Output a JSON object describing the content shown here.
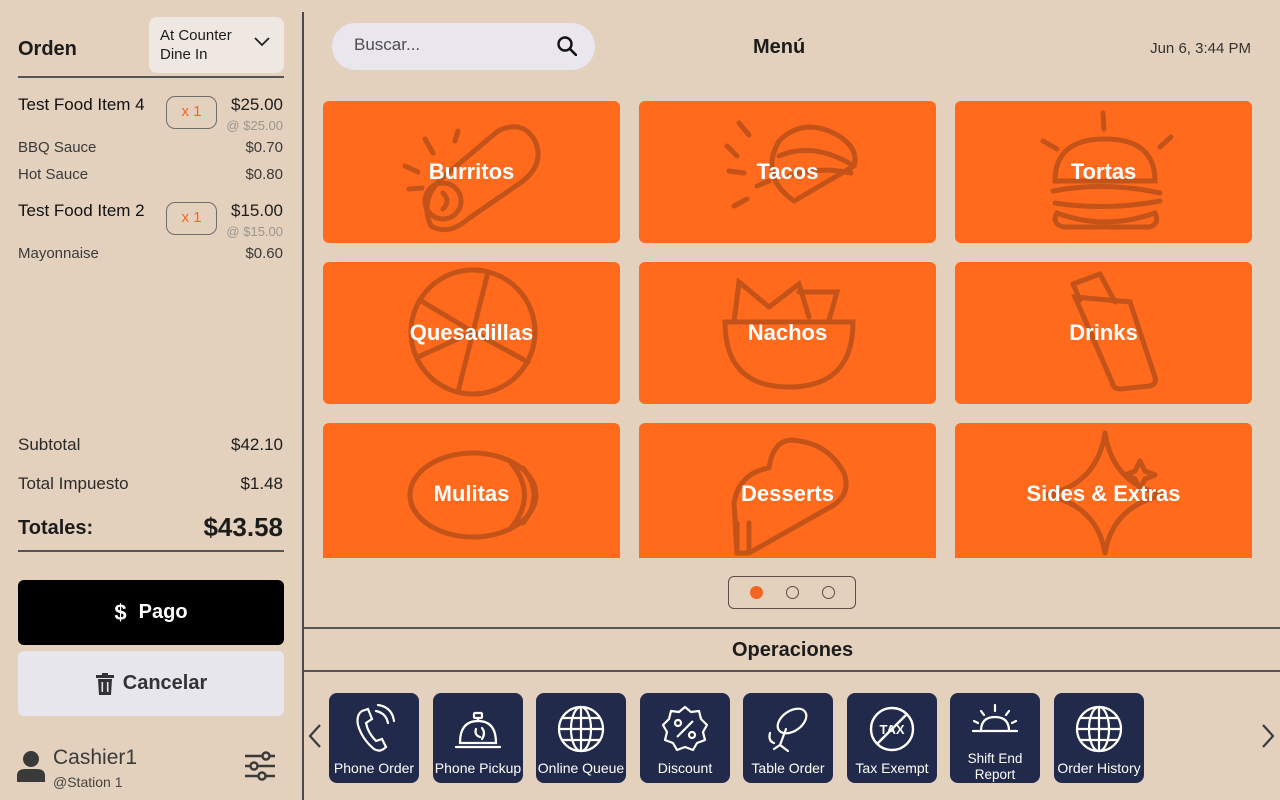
{
  "order": {
    "title": "Orden",
    "type_line1": "At Counter",
    "type_line2": "Dine In",
    "items": [
      {
        "name": "Test Food Item 4",
        "qty": "x 1",
        "price": "$25.00",
        "unit_price": "@ $25.00",
        "modifiers": [
          {
            "name": "BBQ Sauce",
            "price": "$0.70"
          },
          {
            "name": "Hot Sauce",
            "price": "$0.80"
          }
        ]
      },
      {
        "name": "Test Food Item 2",
        "qty": "x 1",
        "price": "$15.00",
        "unit_price": "@ $15.00",
        "modifiers": [
          {
            "name": "Mayonnaise",
            "price": "$0.60"
          }
        ]
      }
    ],
    "subtotal_label": "Subtotal",
    "subtotal": "$42.10",
    "tax_label": "Total Impuesto",
    "tax": "$1.48",
    "total_label": "Totales:",
    "total": "$43.58",
    "pay_label": "Pago",
    "cancel_label": "Cancelar"
  },
  "cashier": {
    "name": "Cashier1",
    "station": "@Station 1"
  },
  "header": {
    "search_placeholder": "Buscar...",
    "title": "Menú",
    "datetime": "Jun 6, 3:44 PM"
  },
  "menu": {
    "categories": [
      {
        "label": "Burritos",
        "icon": "burrito-icon"
      },
      {
        "label": "Tacos",
        "icon": "taco-icon"
      },
      {
        "label": "Tortas",
        "icon": "sandwich-icon"
      },
      {
        "label": "Quesadillas",
        "icon": "quesadilla-icon"
      },
      {
        "label": "Nachos",
        "icon": "nachos-icon"
      },
      {
        "label": "Drinks",
        "icon": "drink-icon"
      },
      {
        "label": "Mulitas",
        "icon": "mulita-icon"
      },
      {
        "label": "Desserts",
        "icon": "dessert-icon"
      },
      {
        "label": "Sides & Extras",
        "icon": "sparkle-icon"
      }
    ],
    "pages": 3,
    "current_page": 1
  },
  "operations": {
    "title": "Operaciones",
    "buttons": [
      {
        "label": "Phone Order",
        "icon": "phone-icon"
      },
      {
        "label": "Phone Pickup",
        "icon": "service-bell-icon"
      },
      {
        "label": "Online Queue",
        "icon": "globe-icon"
      },
      {
        "label": "Discount",
        "icon": "percent-badge-icon"
      },
      {
        "label": "Table Order",
        "icon": "table-icon"
      },
      {
        "label": "Tax Exempt",
        "icon": "tax-exempt-icon"
      },
      {
        "label": "Shift End Report",
        "icon": "sunset-icon"
      },
      {
        "label": "Order History",
        "icon": "globe-icon"
      }
    ]
  },
  "colors": {
    "background": "#e3d1bd",
    "tile": "#ff6a1c",
    "accent": "#f36522",
    "operation_button": "#222a4b",
    "pay_button": "#000000"
  }
}
